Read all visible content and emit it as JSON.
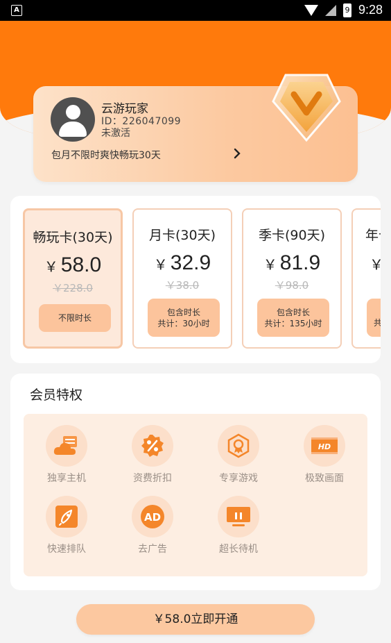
{
  "status_bar": {
    "time": "9:28",
    "battery": "9",
    "app_indicator": "A"
  },
  "profile": {
    "name": "云游玩家",
    "id": "ID：226047099",
    "status": "未激活",
    "promo": "包月不限时爽快畅玩30天"
  },
  "plans": [
    {
      "title": "畅玩卡(30天)",
      "currency": "￥",
      "price": "58.0",
      "original": "￥228.0",
      "desc_line1": "不限时长",
      "desc_line2": "",
      "selected": true
    },
    {
      "title": "月卡(30天)",
      "currency": "￥",
      "price": "32.9",
      "original": "￥38.0",
      "desc_line1": "包含时长",
      "desc_line2": "共计：30小时",
      "selected": false
    },
    {
      "title": "季卡(90天)",
      "currency": "￥",
      "price": "81.9",
      "original": "￥98.0",
      "desc_line1": "包含时长",
      "desc_line2": "共计：135小时",
      "selected": false
    },
    {
      "title": "年卡",
      "currency": "￥",
      "price": "",
      "original": "",
      "desc_line1": "",
      "desc_line2": "共",
      "selected": false
    }
  ],
  "perks": {
    "title": "会员特权",
    "items": [
      {
        "label": "独享主机",
        "icon": "cloud-server-icon"
      },
      {
        "label": "资费折扣",
        "icon": "discount-icon"
      },
      {
        "label": "专享游戏",
        "icon": "game-medal-icon"
      },
      {
        "label": "极致画面",
        "icon": "hd-icon"
      },
      {
        "label": "快速排队",
        "icon": "rocket-icon"
      },
      {
        "label": "去广告",
        "icon": "ad-icon"
      },
      {
        "label": "超长待机",
        "icon": "monitor-icon"
      }
    ]
  },
  "cta": {
    "label": "￥58.0立即开通"
  },
  "colors": {
    "accent": "#ff7a0c",
    "card_peach": "#fcc49c",
    "perk_bg": "#fdeee2"
  }
}
